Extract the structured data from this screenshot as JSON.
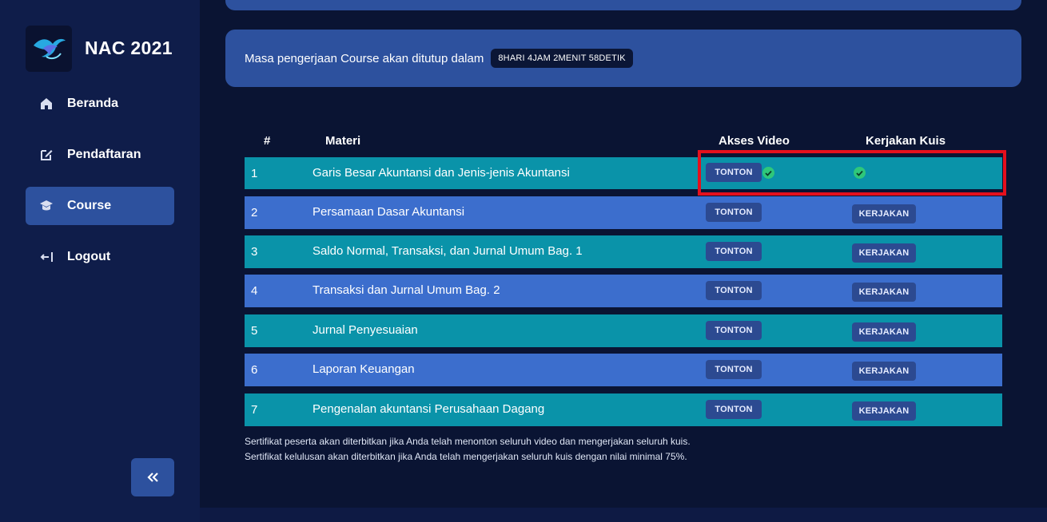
{
  "sidebar": {
    "brand": "NAC 2021",
    "items": [
      {
        "label": "Beranda",
        "icon": "home-icon"
      },
      {
        "label": "Pendaftaran",
        "icon": "edit-icon"
      },
      {
        "label": "Course",
        "icon": "graduation-cap-icon",
        "active": true
      },
      {
        "label": "Logout",
        "icon": "logout-icon"
      }
    ],
    "collapse_icon": "double-chevron-left-icon"
  },
  "timer": {
    "text": "Masa pengerjaan Course akan ditutup dalam",
    "countdown": "8HARI 4JAM 2MENIT 58DETIK"
  },
  "table": {
    "headers": {
      "no": "#",
      "materi": "Materi",
      "video": "Akses Video",
      "quiz": "Kerjakan Kuis"
    },
    "rows": [
      {
        "no": "1",
        "title": "Garis Besar Akuntansi dan Jenis-jenis Akuntansi",
        "watch_label": "TONTON",
        "video_done": true,
        "quiz_label": "",
        "quiz_done": true
      },
      {
        "no": "2",
        "title": "Persamaan Dasar Akuntansi",
        "watch_label": "TONTON",
        "video_done": false,
        "quiz_label": "KERJAKAN",
        "quiz_done": false
      },
      {
        "no": "3",
        "title": "Saldo Normal, Transaksi, dan Jurnal Umum Bag. 1",
        "watch_label": "TONTON",
        "video_done": false,
        "quiz_label": "KERJAKAN",
        "quiz_done": false
      },
      {
        "no": "4",
        "title": "Transaksi dan Jurnal Umum Bag. 2",
        "watch_label": "TONTON",
        "video_done": false,
        "quiz_label": "KERJAKAN",
        "quiz_done": false
      },
      {
        "no": "5",
        "title": "Jurnal Penyesuaian",
        "watch_label": "TONTON",
        "video_done": false,
        "quiz_label": "KERJAKAN",
        "quiz_done": false
      },
      {
        "no": "6",
        "title": "Laporan Keuangan",
        "watch_label": "TONTON",
        "video_done": false,
        "quiz_label": "KERJAKAN",
        "quiz_done": false
      },
      {
        "no": "7",
        "title": "Pengenalan akuntansi Perusahaan Dagang",
        "watch_label": "TONTON",
        "video_done": false,
        "quiz_label": "KERJAKAN",
        "quiz_done": false
      }
    ]
  },
  "notes": [
    "Sertifikat peserta akan diterbitkan jika Anda telah menonton seluruh video dan mengerjakan seluruh kuis.",
    "Sertifikat kelulusan akan diterbitkan jika Anda telah mengerjakan seluruh kuis dengan nilai minimal 75%."
  ],
  "colors": {
    "sidebar_bg": "#0f1d4a",
    "main_bg": "#0a1433",
    "card_bg": "#2d519e",
    "row_teal": "#0a93a9",
    "row_blue": "#3c6ecd",
    "check_green": "#2fc77a",
    "highlight_red": "#e4101d"
  }
}
